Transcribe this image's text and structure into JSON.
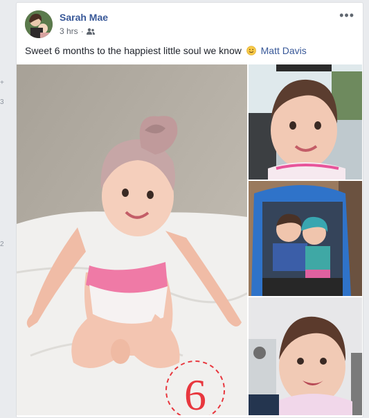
{
  "gutter": {
    "marks": [
      "+",
      "3",
      "2"
    ]
  },
  "post": {
    "author": "Sarah Mae",
    "time": "3 hrs",
    "separator": "·",
    "audience_icon": "friends-icon",
    "more_label": "•••",
    "text": "Sweet 6 months to the happiest little soul we know",
    "emoji_icon": "slightly-smiling-face-icon",
    "mention": "Matt Davis",
    "milestone_number": "6"
  },
  "colors": {
    "link": "#385898",
    "text": "#1d2129",
    "muted": "#616770",
    "milestone": "#e8373e"
  }
}
